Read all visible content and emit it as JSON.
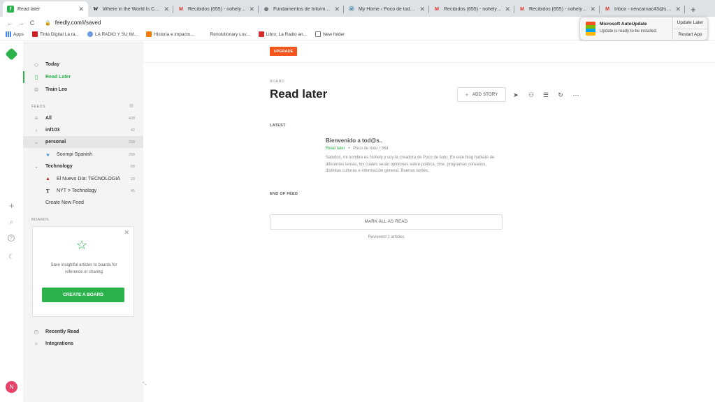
{
  "browser": {
    "tabs": [
      {
        "title": "Read later",
        "icon": "feedly-icon",
        "color": "#2bb24c",
        "glyph": "f",
        "active": true
      },
      {
        "title": "Where in the World Is Carme",
        "icon": "wikipedia-icon",
        "color": "#ffffff",
        "glyph": "W",
        "active": false
      },
      {
        "title": "Recibidos (655) - nohelyencr",
        "icon": "gmail-icon",
        "color": "#ffffff",
        "glyph": "M",
        "active": false
      },
      {
        "title": "Fundamentos de Informática",
        "icon": "globe-icon",
        "color": "#ffffff",
        "glyph": "◍",
        "active": false
      },
      {
        "title": "My Home ‹ Poco de todo — W",
        "icon": "wordpress-icon",
        "color": "#ffffff",
        "glyph": "ⓦ",
        "active": false
      },
      {
        "title": "Recibidos (655) - nohelyencr",
        "icon": "gmail-icon",
        "color": "#ffffff",
        "glyph": "M",
        "active": false
      },
      {
        "title": "Recibidos (655) - nohelyencr",
        "icon": "gmail-icon",
        "color": "#ffffff",
        "glyph": "M",
        "active": false
      },
      {
        "title": "Inbox - nencarnac43@sagrad",
        "icon": "gmail-icon",
        "color": "#ffffff",
        "glyph": "M",
        "active": false
      }
    ],
    "close_glyph": "✕",
    "new_tab": "+",
    "back": "←",
    "forward": "→",
    "reload": "C",
    "lock": "🔒",
    "url": "feedly.com/i/saved",
    "bookmarks": [
      {
        "label": "Apps",
        "color": "#4285f4"
      },
      {
        "label": "Tinta Digital La ra...",
        "color": "#cc2222"
      },
      {
        "label": "LA RADIO Y SU IM...",
        "color": "#6a9be0"
      },
      {
        "label": "Historia e impacto...",
        "color": "#f57c00"
      },
      {
        "label": "Revolutionary Lov...",
        "color": "#ffffff"
      },
      {
        "label": "Libro: La Radio an...",
        "color": "#d32f2f"
      },
      {
        "label": "New folder",
        "color": "#777777"
      }
    ]
  },
  "notification": {
    "title": "Microsoft AutoUpdate",
    "message": "Update is ready to be installed.",
    "update_later": "Update Later",
    "restart_app": "Restart App"
  },
  "rail": {
    "add": "+",
    "search": "⌕",
    "help": "?",
    "night": "☾",
    "avatar": "N"
  },
  "sidebar": {
    "today": "Today",
    "read_later": "Read Later",
    "train": "Train Leo",
    "feeds_header": "FEEDS",
    "feeds": [
      {
        "label": "All",
        "count": "408",
        "icon": "≡"
      },
      {
        "label": "inf103",
        "count": "42",
        "icon": "›"
      },
      {
        "label": "personal",
        "count": "258",
        "icon": "⌄"
      },
      {
        "label": "Soompi Spanish",
        "count": "258",
        "icon": "★"
      },
      {
        "label": "Technology",
        "count": "68",
        "icon": "⌄"
      },
      {
        "label": "El Nuevo Día: TECNOLOGIA",
        "count": "23",
        "icon": "▲"
      },
      {
        "label": "NYT > Technology",
        "count": "45",
        "icon": "T"
      }
    ],
    "create_feed": "Create New Feed",
    "boards_header": "BOARDS",
    "board_card": {
      "close": "✕",
      "star": "☆",
      "text": "Save insightful articles to boards for reference or sharing",
      "button": "CREATE A BOARD"
    },
    "recently_read": "Recently Read",
    "integrations": "Integrations"
  },
  "main": {
    "upgrade": "UPGRADE",
    "kicker": "BOARD",
    "title": "Read later",
    "add_story": "ADD STORY",
    "latest": "LATEST",
    "article": {
      "title": "Bienvenido a tod@s..",
      "board": "Read later",
      "sep": "•",
      "source": "Poco de todo / 36d",
      "summary": "Saludos, mi nombre es Nohely y soy la creadora de Poco de todo. En este blog hablaré de diferentes temas, los cuales serán opiniones sobre política, cine, programas coreanos, distintas culturas e información general. Buenas tardes,"
    },
    "end_of_feed": "END OF FEED",
    "mark_all": "MARK ALL AS READ",
    "reviewed": "Reviewed 1 articles"
  },
  "colors": {
    "accent": "#2bb24c",
    "upgrade": "#f5541a",
    "avatar": "#e8416a"
  }
}
